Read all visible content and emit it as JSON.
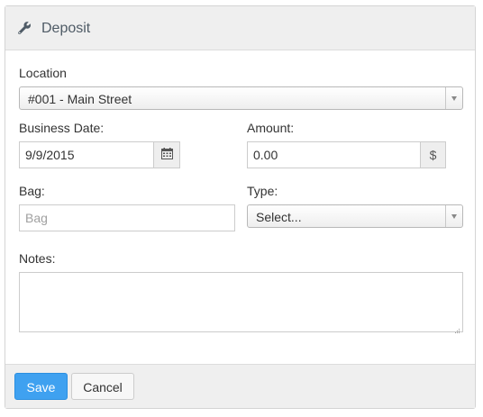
{
  "header": {
    "title": "Deposit",
    "icon": "wrench-icon"
  },
  "form": {
    "location": {
      "label": "Location",
      "value": "#001 - Main Street"
    },
    "business_date": {
      "label": "Business Date:",
      "value": "9/9/2015",
      "icon": "calendar-icon"
    },
    "amount": {
      "label": "Amount:",
      "value": "0.00",
      "addon": "$"
    },
    "bag": {
      "label": "Bag:",
      "value": "",
      "placeholder": "Bag"
    },
    "type": {
      "label": "Type:",
      "value": "Select..."
    },
    "notes": {
      "label": "Notes:",
      "value": ""
    }
  },
  "footer": {
    "save_label": "Save",
    "cancel_label": "Cancel"
  },
  "colors": {
    "primary": "#3fa1f0",
    "header_bg": "#efefef",
    "header_text": "#4f5b66"
  }
}
